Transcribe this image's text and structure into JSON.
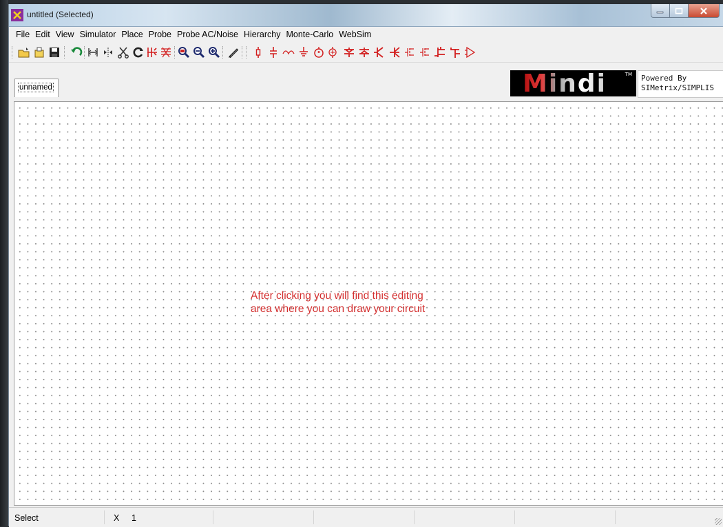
{
  "window": {
    "title": "untitled (Selected)"
  },
  "menu": [
    "File",
    "Edit",
    "View",
    "Simulator",
    "Place",
    "Probe",
    "Probe AC/Noise",
    "Hierarchy",
    "Monte-Carlo",
    "WebSim"
  ],
  "toolbar": {
    "icons": [
      "open-icon",
      "new-icon",
      "save-icon",
      "undo-icon",
      "flip-icon",
      "mirror-icon",
      "cut-icon",
      "rotate-icon",
      "wire-icon",
      "bus-icon",
      "zoom-fit-icon",
      "zoom-out-icon",
      "zoom-in-icon",
      "pencil-icon",
      "resistor-icon",
      "capacitor-icon",
      "inductor-icon",
      "ground-icon",
      "voltage-source-icon",
      "current-source-icon",
      "diode-icon",
      "zener-icon",
      "npn-icon",
      "pnp-icon",
      "nmos-icon",
      "pmos-icon",
      "jfet-n-icon",
      "jfet-p-icon",
      "opamp-icon"
    ]
  },
  "tabs": [
    {
      "label": "unnamed"
    }
  ],
  "branding": {
    "logo_text": "Mindi",
    "tm": "TM",
    "powered_line1": "Powered By",
    "powered_line2": "SIMetrix/SIMPLIS"
  },
  "canvas": {
    "note_line1": "After clicking you will find this editing",
    "note_line2": "area where you can draw your circuit"
  },
  "status": {
    "mode": "Select",
    "coord_label": "X",
    "coord_value": "1"
  },
  "colors": {
    "note": "#d32f2f",
    "component_icons": "#d21e1e"
  }
}
